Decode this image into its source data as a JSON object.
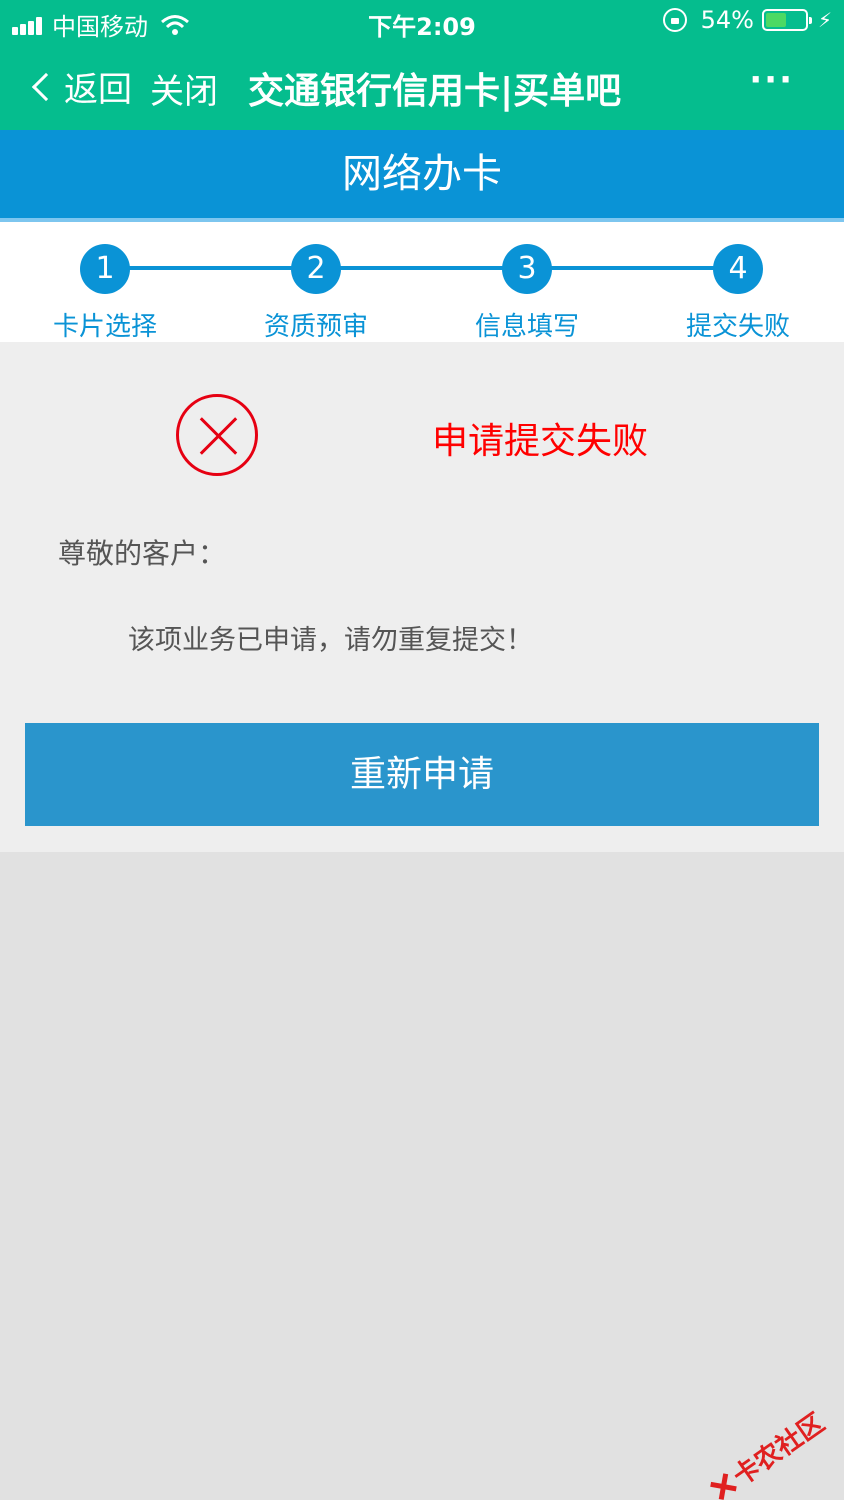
{
  "status_bar": {
    "carrier": "中国移动",
    "time": "下午2:09",
    "battery_percent": "54%",
    "battery_level": 0.54
  },
  "nav": {
    "back_label": "返回",
    "close_label": "关闭",
    "title": "交通银行信用卡|买单吧",
    "more_label": "···"
  },
  "header": {
    "title": "网络办卡"
  },
  "steps": [
    {
      "number": "1",
      "label": "卡片选择"
    },
    {
      "number": "2",
      "label": "资质预审"
    },
    {
      "number": "3",
      "label": "信息填写"
    },
    {
      "number": "4",
      "label": "提交失败"
    }
  ],
  "result": {
    "title": "申请提交失败",
    "greeting": "尊敬的客户：",
    "message": "该项业务已申请，请勿重复提交！",
    "retry_label": "重新申请"
  },
  "watermark": {
    "text": "卡农社区"
  },
  "colors": {
    "nav_green": "#05bd8e",
    "header_blue": "#0a93d6",
    "error_red": "#ff0000",
    "button_blue": "#2a95cc"
  }
}
